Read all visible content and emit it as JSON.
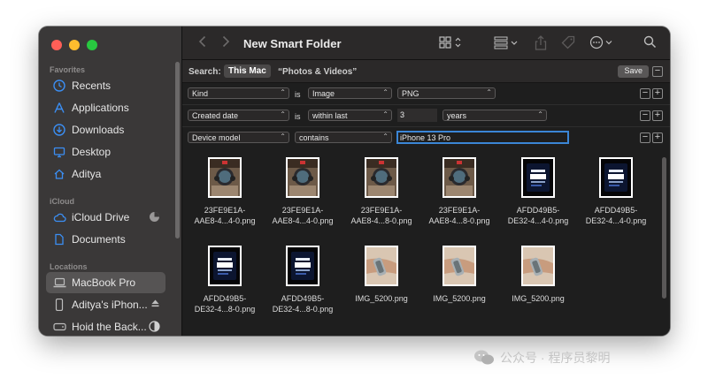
{
  "toolbar": {
    "title": "New Smart Folder"
  },
  "sidebar": {
    "favorites_label": "Favorites",
    "favorites": [
      {
        "label": "Recents",
        "icon": "clock-icon"
      },
      {
        "label": "Applications",
        "icon": "applications-icon"
      },
      {
        "label": "Downloads",
        "icon": "download-icon"
      },
      {
        "label": "Desktop",
        "icon": "desktop-icon"
      },
      {
        "label": "Aditya",
        "icon": "home-icon"
      }
    ],
    "icloud_label": "iCloud",
    "icloud": [
      {
        "label": "iCloud Drive",
        "icon": "cloud-icon"
      },
      {
        "label": "Documents",
        "icon": "document-icon"
      }
    ],
    "locations_label": "Locations",
    "locations": [
      {
        "label": "MacBook Pro",
        "icon": "laptop-icon"
      },
      {
        "label": "Aditya's iPhon...",
        "icon": "iphone-icon"
      },
      {
        "label": "Hoid the Back...",
        "icon": "disk-icon"
      }
    ]
  },
  "search": {
    "label": "Search:",
    "scope_active": "This Mac",
    "scope_other": "“Photos & Videos”",
    "save_label": "Save"
  },
  "criteria": [
    {
      "attribute": "Kind",
      "operator": "is",
      "value_popup": "Image",
      "value2": "PNG"
    },
    {
      "attribute": "Created date",
      "operator": "is",
      "value_popup": "within last",
      "value_field": "3",
      "unit": "years"
    },
    {
      "attribute": "Device model",
      "operator_popup": "contains",
      "value_field": "iPhone 13 Pro"
    }
  ],
  "files": [
    {
      "name1": "23FE9E1A-",
      "name2": "AAE8-4...4-0.png",
      "kind": "car"
    },
    {
      "name1": "23FE9E1A-",
      "name2": "AAE8-4...4-0.png",
      "kind": "car"
    },
    {
      "name1": "23FE9E1A-",
      "name2": "AAE8-4...8-0.png",
      "kind": "car"
    },
    {
      "name1": "23FE9E1A-",
      "name2": "AAE8-4...8-0.png",
      "kind": "car"
    },
    {
      "name1": "AFDD49B5-",
      "name2": "DE32-4...4-0.png",
      "kind": "screen"
    },
    {
      "name1": "AFDD49B5-",
      "name2": "DE32-4...4-0.png",
      "kind": "screen"
    },
    {
      "name1": "AFDD49B5-",
      "name2": "DE32-4...8-0.png",
      "kind": "screen"
    },
    {
      "name1": "AFDD49B5-",
      "name2": "DE32-4...8-0.png",
      "kind": "screen"
    },
    {
      "name1": "IMG_5200.png",
      "name2": "",
      "kind": "wrist"
    },
    {
      "name1": "IMG_5200.png",
      "name2": "",
      "kind": "wrist"
    },
    {
      "name1": "IMG_5200.png",
      "name2": "",
      "kind": "wrist"
    }
  ],
  "watermark": {
    "text": "公众号 · 程序员黎明"
  },
  "colors": {
    "accent": "#3b86d6",
    "sidebar_icon": "#3b8ef3"
  }
}
